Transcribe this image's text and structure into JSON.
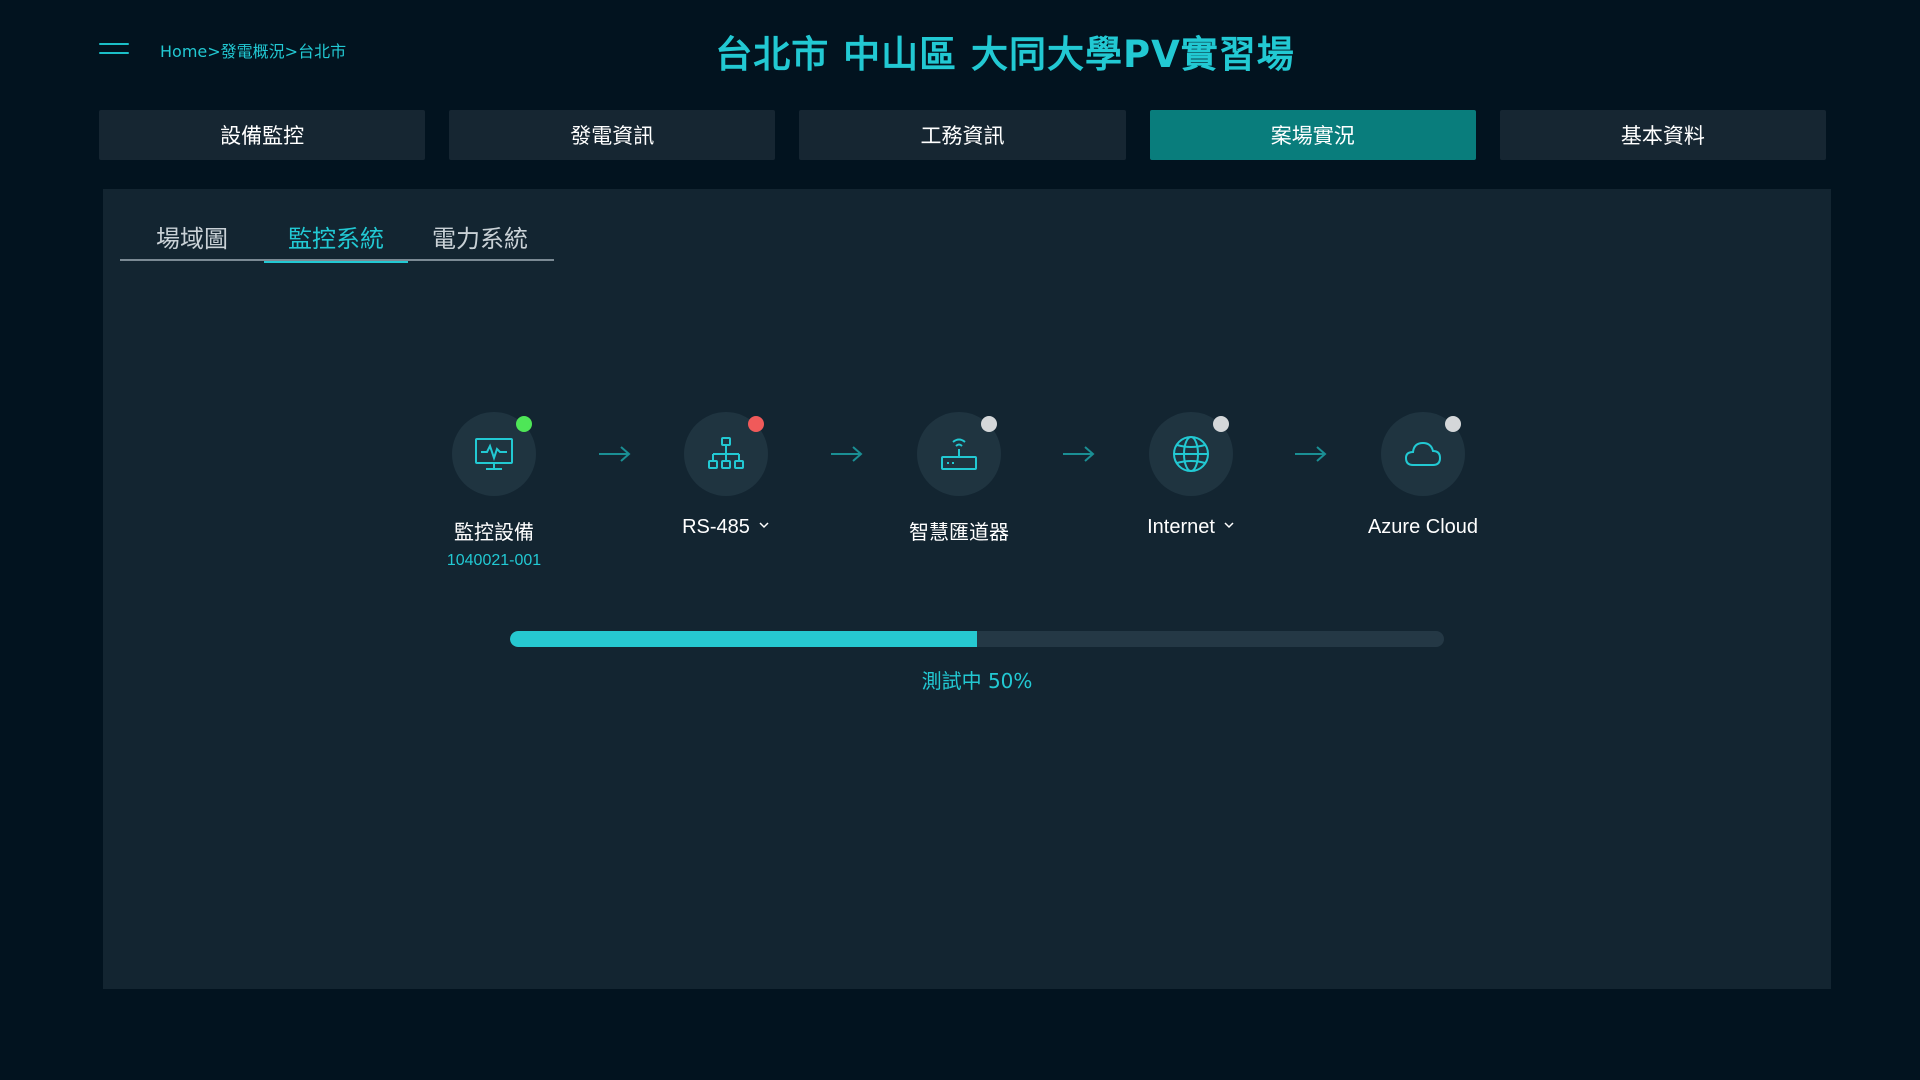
{
  "header": {
    "breadcrumb": {
      "home": "Home",
      "sep1": ">",
      "level2": "發電概況",
      "sep2": ">",
      "level3": "台北市"
    },
    "title": "台北市 中山區 大同大學PV實習場"
  },
  "main_tabs": [
    {
      "label": "設備監控",
      "active": false
    },
    {
      "label": "發電資訊",
      "active": false
    },
    {
      "label": "工務資訊",
      "active": false
    },
    {
      "label": "案場實況",
      "active": true
    },
    {
      "label": "基本資料",
      "active": false
    }
  ],
  "sub_tabs": [
    {
      "label": "場域圖",
      "active": false
    },
    {
      "label": "監控系統",
      "active": true
    },
    {
      "label": "電力系統",
      "active": false
    }
  ],
  "nodes": [
    {
      "label": "監控設備",
      "sublabel": "1040021-001",
      "icon": "monitor-icon",
      "status": "online",
      "status_color": "#4ee657",
      "dropdown": false
    },
    {
      "label": "RS-485",
      "icon": "network-icon",
      "status": "error",
      "status_color": "#f05a5a",
      "dropdown": true
    },
    {
      "label": "智慧匯道器",
      "icon": "router-icon",
      "status": "unknown",
      "status_color": "#d4d7d9",
      "dropdown": false
    },
    {
      "label": "Internet",
      "icon": "globe-icon",
      "status": "unknown",
      "status_color": "#d4d7d9",
      "dropdown": true
    },
    {
      "label": "Azure Cloud",
      "icon": "cloud-icon",
      "status": "unknown",
      "status_color": "#d4d7d9",
      "dropdown": false
    }
  ],
  "progress": {
    "value": 0.5,
    "text": "測試中 50%"
  },
  "colors": {
    "accent": "#22c9d3",
    "active_tab": "#097d7c",
    "background": "#02131f",
    "panel": "#132531"
  }
}
